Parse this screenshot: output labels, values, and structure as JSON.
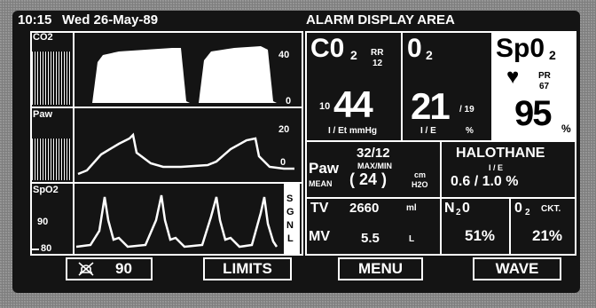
{
  "header": {
    "time": "10:15",
    "date": "Wed  26-May-89",
    "alarm_title": "ALARM DISPLAY AREA"
  },
  "waveforms": {
    "co2": {
      "label": "CO2",
      "scale_top": "40",
      "scale_zero": "0"
    },
    "paw": {
      "label": "Paw",
      "scale_top": "20",
      "scale_zero": "0"
    },
    "spo2": {
      "label": "SpO2",
      "scale_top": "90",
      "scale_bottom": "80",
      "signal_letters": [
        "S",
        "G",
        "N",
        "L"
      ]
    }
  },
  "co2_panel": {
    "title": "C0",
    "sub": "2",
    "rr_label": "RR",
    "rr_value": "12",
    "small_value": "10",
    "value": "44",
    "footer": "I / Et   mmHg"
  },
  "o2_panel": {
    "title": "0",
    "sub": "2",
    "value": "21",
    "small_value": "/ 19",
    "footer_ie": "I / E",
    "footer_unit": "%"
  },
  "spo2_panel": {
    "title": "Sp0",
    "sub": "2",
    "pr_label": "PR",
    "pr_value": "67",
    "value": "95",
    "unit": "%",
    "heart_icon": "heart-icon"
  },
  "paw_panel": {
    "title": "Paw",
    "mean_label": "MEAN",
    "values": "32/12",
    "maxmin_label": "MAX/MIN",
    "mean_value": "( 24 )",
    "unit_top": "cm",
    "unit_bottom": "H2O"
  },
  "halothane_panel": {
    "title": "HALOTHANE",
    "ie_label": "I / E",
    "value": "0.6 / 1.0 %"
  },
  "tv_panel": {
    "tv_label": "TV",
    "tv_value": "2660",
    "tv_unit": "ml",
    "mv_label": "MV",
    "mv_value": "5.5",
    "mv_unit": "L"
  },
  "n2o_panel": {
    "title": "N",
    "sub": "2",
    "title_tail": "0",
    "value": "51%"
  },
  "o2ckt_panel": {
    "title": "0",
    "sub": "2",
    "ckt_label": "CKT.",
    "value": "21%"
  },
  "buttons": {
    "alarm_silence": {
      "icon": "alarm-silenced-icon",
      "value": "90"
    },
    "limits": "LIMITS",
    "menu": "MENU",
    "wave": "WAVE"
  }
}
